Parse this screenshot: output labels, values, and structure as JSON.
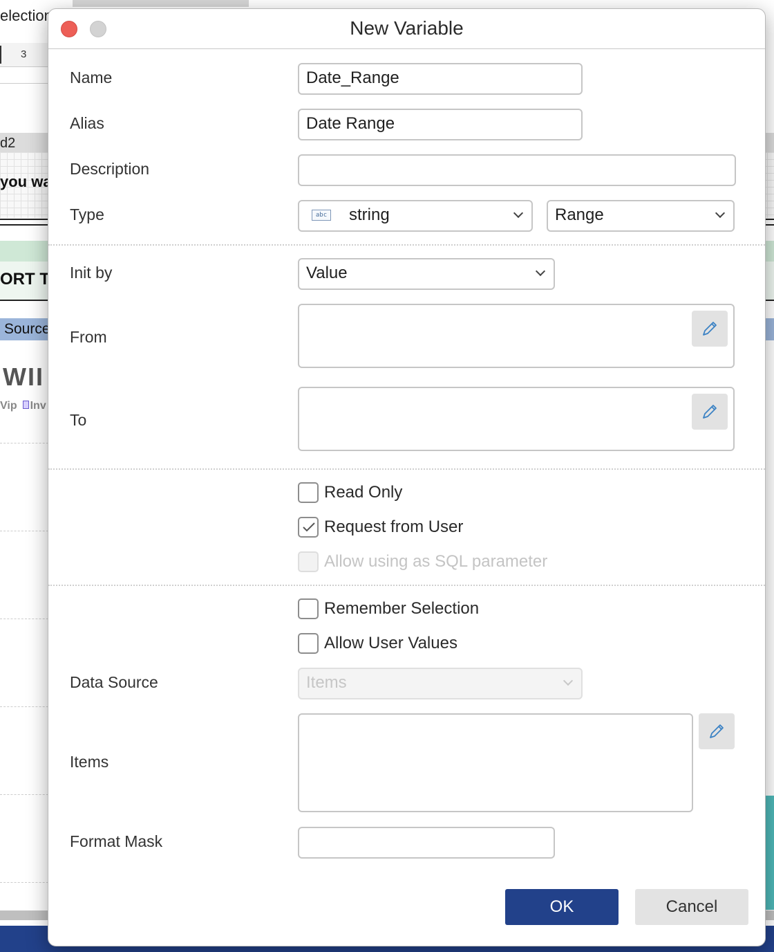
{
  "background": {
    "selection_title": "election",
    "ruler_number": "3",
    "band_label": "d2",
    "question_text": "you wa",
    "report_title": "ORT T",
    "source_label": "Source",
    "wip_title": "WII",
    "legend_wip": "Vip",
    "legend_inv": "Inv"
  },
  "dialog": {
    "title": "New Variable",
    "name": {
      "label": "Name",
      "value": "Date_Range"
    },
    "alias": {
      "label": "Alias",
      "value": "Date Range"
    },
    "description": {
      "label": "Description",
      "value": ""
    },
    "type": {
      "label": "Type",
      "icon_text": "abc",
      "value": "string",
      "kind": "Range"
    },
    "init_by": {
      "label": "Init by",
      "value": "Value"
    },
    "from": {
      "label": "From"
    },
    "to": {
      "label": "To"
    },
    "checkboxes": {
      "read_only": {
        "label": "Read Only",
        "checked": false
      },
      "request_from_user": {
        "label": "Request from User",
        "checked": true
      },
      "allow_sql_param": {
        "label": "Allow using as SQL parameter",
        "checked": false,
        "disabled": true
      },
      "remember_selection": {
        "label": "Remember Selection",
        "checked": false
      },
      "allow_user_values": {
        "label": "Allow User Values",
        "checked": false
      }
    },
    "data_source": {
      "label": "Data Source",
      "value": "Items"
    },
    "items": {
      "label": "Items"
    },
    "format_mask": {
      "label": "Format Mask",
      "value": ""
    },
    "buttons": {
      "ok": "OK",
      "cancel": "Cancel"
    }
  },
  "colors": {
    "primary_button": "#22418a",
    "close_button": "#ed5f57",
    "checkmark": "#555555"
  }
}
